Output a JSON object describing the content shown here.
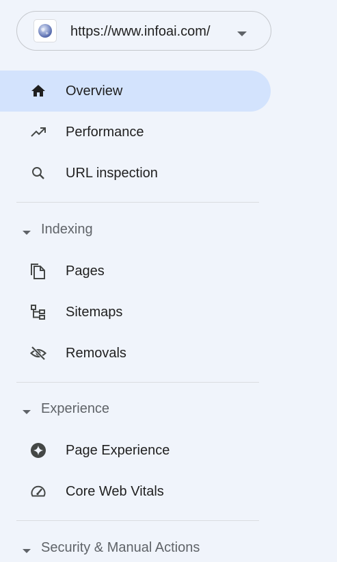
{
  "property": {
    "url": "https://www.infoai.com/",
    "favicon_icon": "globe-icon",
    "dropdown_icon": "arrow-drop-down-icon"
  },
  "colors": {
    "background": "#f0f4fb",
    "selected_background": "#d3e3fd",
    "text": "#1f1f1f",
    "section_text": "#5f6368",
    "icon": "#444746",
    "divider": "#dadce0"
  },
  "nav": {
    "top_items": [
      {
        "label": "Overview",
        "icon": "home-icon",
        "selected": true
      },
      {
        "label": "Performance",
        "icon": "trending-up-icon",
        "selected": false
      },
      {
        "label": "URL inspection",
        "icon": "search-icon",
        "selected": false
      }
    ],
    "sections": [
      {
        "title": "Indexing",
        "expanded": true,
        "items": [
          {
            "label": "Pages",
            "icon": "pages-icon"
          },
          {
            "label": "Sitemaps",
            "icon": "sitemap-icon"
          },
          {
            "label": "Removals",
            "icon": "visibility-off-icon"
          }
        ]
      },
      {
        "title": "Experience",
        "expanded": true,
        "items": [
          {
            "label": "Page Experience",
            "icon": "page-experience-icon"
          },
          {
            "label": "Core Web Vitals",
            "icon": "speed-gauge-icon"
          }
        ]
      },
      {
        "title": "Security & Manual Actions",
        "expanded": true,
        "items": []
      }
    ]
  }
}
